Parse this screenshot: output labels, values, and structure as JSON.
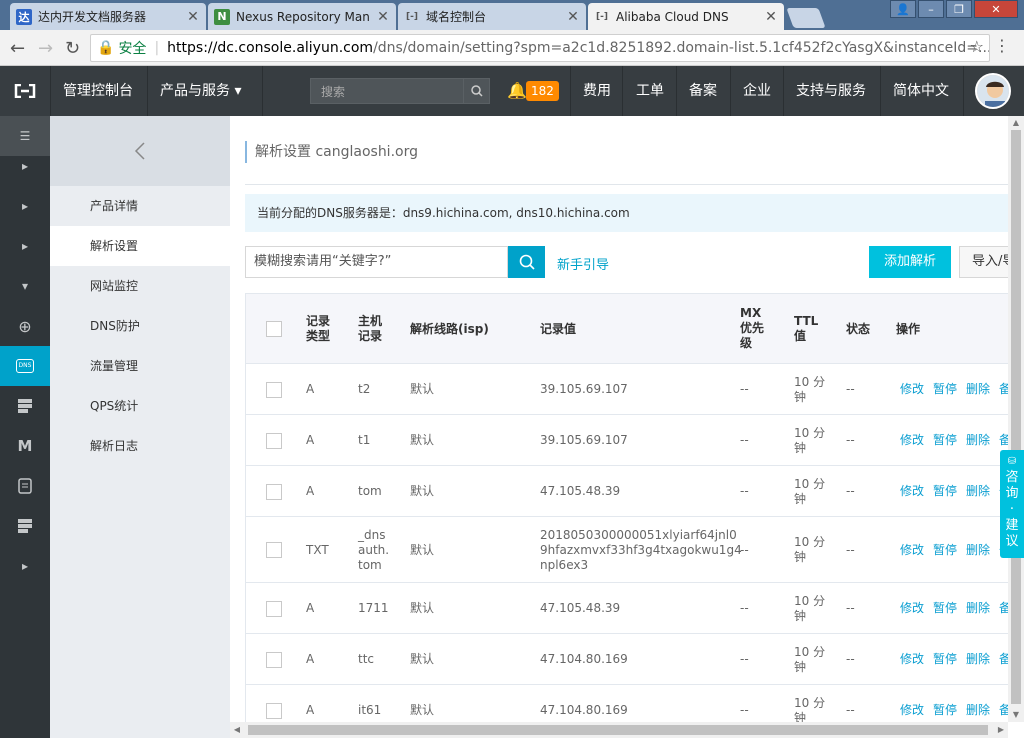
{
  "browser": {
    "tabs": [
      {
        "title": "达内开发文档服务器",
        "icon": "tarena-favicon",
        "icon_letter": "达",
        "icon_color": "#2f66c7"
      },
      {
        "title": "Nexus Repository Man",
        "icon": "nexus-favicon",
        "icon_letter": "N",
        "icon_color": "#3e8e41"
      },
      {
        "title": "域名控制台",
        "icon": "aliyun-favicon",
        "icon_letter": "[-]",
        "icon_color": "#555555"
      },
      {
        "title": "Alibaba Cloud DNS",
        "icon": "aliyun-favicon",
        "icon_letter": "[-]",
        "icon_color": "#555555",
        "active": true
      }
    ],
    "secure_label": "安全",
    "url_host": "https://dc.console.aliyun.com",
    "url_rest": "/dns/domain/setting?spm=a2c1d.8251892.domain-list.5.1cf452f2cYasgX&instanceId=..."
  },
  "topnav": {
    "console_label": "管理控制台",
    "products_label": "产品与服务 ▾",
    "search_placeholder": "搜索",
    "notification_count": "182",
    "items": [
      "费用",
      "工单",
      "备案",
      "企业",
      "支持与服务",
      "简体中文"
    ]
  },
  "sidebar": {
    "items": [
      {
        "label": "产品详情"
      },
      {
        "label": "解析设置",
        "active": true
      },
      {
        "label": "网站监控"
      },
      {
        "label": "DNS防护"
      },
      {
        "label": "流量管理"
      },
      {
        "label": "QPS统计"
      },
      {
        "label": "解析日志"
      }
    ]
  },
  "main": {
    "breadcrumb": "解析设置 canglaoshi.org",
    "notice": "当前分配的DNS服务器是：dns9.hichina.com, dns10.hichina.com",
    "search_placeholder": "模糊搜索请用“关键字?”",
    "guide_link": "新手引导",
    "add_button": "添加解析",
    "import_button": "导入/导"
  },
  "table": {
    "headers": {
      "type": "记录\n类型",
      "host": "主机\n记录",
      "line": "解析线路(isp)",
      "value": "记录值",
      "mx": "MX\n优先\n级",
      "ttl": "TTL\n值",
      "status": "状态",
      "ops": "操作"
    },
    "op_labels": [
      "修改",
      "暂停",
      "删除",
      "备"
    ],
    "rows": [
      {
        "type": "A",
        "host": "t2",
        "line": "默认",
        "value": "39.105.69.107",
        "mx": "--",
        "ttl": "10 分\n钟",
        "status": "--"
      },
      {
        "type": "A",
        "host": "t1",
        "line": "默认",
        "value": "39.105.69.107",
        "mx": "--",
        "ttl": "10 分\n钟",
        "status": "--"
      },
      {
        "type": "A",
        "host": "tom",
        "line": "默认",
        "value": "47.105.48.39",
        "mx": "--",
        "ttl": "10 分\n钟",
        "status": "--"
      },
      {
        "type": "TXT",
        "host": "_dns\nauth.\ntom",
        "line": "默认",
        "value": "2018050300000051xlyiarf64jnl0\n9hfazxmvxf33hf3g4txagokwu1g4\nnpl6ex3",
        "mx": "--",
        "ttl": "10 分\n钟",
        "status": "--"
      },
      {
        "type": "A",
        "host": "1711",
        "line": "默认",
        "value": "47.105.48.39",
        "mx": "--",
        "ttl": "10 分\n钟",
        "status": "--"
      },
      {
        "type": "A",
        "host": "ttc",
        "line": "默认",
        "value": "47.104.80.169",
        "mx": "--",
        "ttl": "10 分\n钟",
        "status": "--"
      },
      {
        "type": "A",
        "host": "it61",
        "line": "默认",
        "value": "47.104.80.169",
        "mx": "--",
        "ttl": "10 分\n钟",
        "status": "--"
      }
    ]
  },
  "feedback": "咨\n询\n·\n建\n议",
  "colors": {
    "accent": "#00c1de",
    "link": "#0a9ed1",
    "topnav": "#373d41",
    "badge": "#ff8a00"
  }
}
